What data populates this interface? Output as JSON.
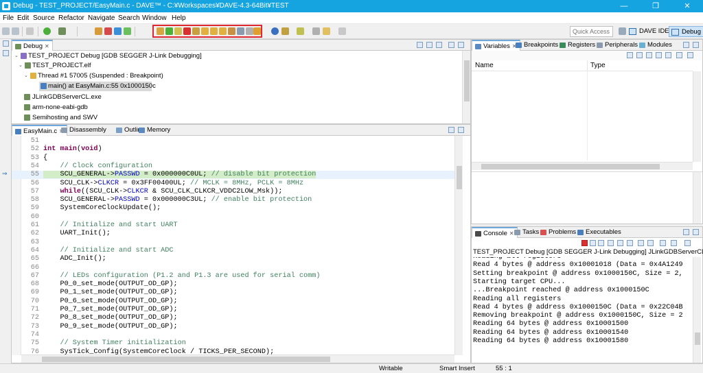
{
  "window": {
    "title": "Debug - TEST_PROJECT/EasyMain.c - DAVE™ - C:¥Workspaces¥DAVE-4.3-64Bit¥TEST",
    "minimize": "—",
    "maximize": "❐",
    "close": "✕"
  },
  "menu": [
    "File",
    "Edit",
    "Source",
    "Refactor",
    "Navigate",
    "Search",
    "Window",
    "Help"
  ],
  "toolbar": {
    "quick_access_placeholder": "Quick Access",
    "perspectives": [
      "DAVE IDE",
      "Debug"
    ],
    "highlight_color": "#e0262f"
  },
  "debug_view": {
    "tab": "Debug",
    "tree": [
      {
        "label": "TEST_PROJECT Debug [GDB SEGGER J-Link Debugging]",
        "twisty": "⌄"
      },
      {
        "label": "TEST_PROJECT.elf",
        "twisty": "⌄"
      },
      {
        "label": "Thread #1 57005 (Suspended : Breakpoint)",
        "twisty": "⌄"
      },
      {
        "label": "main() at EasyMain.c:55 0x1000150c",
        "twisty": ""
      },
      {
        "label": "JLinkGDBServerCL.exe",
        "twisty": ""
      },
      {
        "label": "arm-none-eabi-gdb",
        "twisty": ""
      },
      {
        "label": "Semihosting and SWV",
        "twisty": ""
      }
    ]
  },
  "editor": {
    "tabs": [
      "EasyMain.c",
      "Disassembly",
      "Outline",
      "Memory"
    ],
    "lines": [
      {
        "n": "51",
        "segs": []
      },
      {
        "n": "52",
        "segs": [
          {
            "t": "int",
            "c": "kw"
          },
          {
            "t": " "
          },
          {
            "t": "main",
            "c": "kw"
          },
          {
            "t": "("
          },
          {
            "t": "void",
            "c": "kw"
          },
          {
            "t": ")"
          }
        ]
      },
      {
        "n": "53",
        "segs": [
          {
            "t": "{"
          }
        ]
      },
      {
        "n": "54",
        "segs": [
          {
            "t": "    // Clock configuration",
            "c": "cm"
          }
        ]
      },
      {
        "n": "55",
        "segs": [
          {
            "t": "    SCU_GENERAL->",
            "c": "hlgreen"
          },
          {
            "t": "PASSWD",
            "c": "fld hlgreen"
          },
          {
            "t": " = 0x000000C0UL; ",
            "c": "hlgreen"
          },
          {
            "t": "// disable bit protection",
            "c": "cm hlgreen"
          }
        ]
      },
      {
        "n": "56",
        "segs": [
          {
            "t": "    SCU_CLK->"
          },
          {
            "t": "CLKCR",
            "c": "fld"
          },
          {
            "t": " = 0x3FF00400UL; "
          },
          {
            "t": "// MCLK = 8MHz, PCLK = 8MHz",
            "c": "cm"
          }
        ]
      },
      {
        "n": "57",
        "segs": [
          {
            "t": "    "
          },
          {
            "t": "while",
            "c": "kw"
          },
          {
            "t": "((SCU_CLK->"
          },
          {
            "t": "CLKCR",
            "c": "fld"
          },
          {
            "t": " & SCU_CLK_CLKCR_VDDC2LOW_Msk));"
          }
        ]
      },
      {
        "n": "58",
        "segs": [
          {
            "t": "    SCU_GENERAL->"
          },
          {
            "t": "PASSWD",
            "c": "fld"
          },
          {
            "t": " = 0x000000C3UL; "
          },
          {
            "t": "// enable bit protection",
            "c": "cm"
          }
        ]
      },
      {
        "n": "59",
        "segs": [
          {
            "t": "    SystemCoreClockUpdate();"
          }
        ]
      },
      {
        "n": "60",
        "segs": []
      },
      {
        "n": "61",
        "segs": [
          {
            "t": "    // Initialize and start UART",
            "c": "cm"
          }
        ]
      },
      {
        "n": "62",
        "segs": [
          {
            "t": "    UART_Init();"
          }
        ]
      },
      {
        "n": "63",
        "segs": []
      },
      {
        "n": "64",
        "segs": [
          {
            "t": "    // Initialize and start ADC",
            "c": "cm"
          }
        ]
      },
      {
        "n": "65",
        "segs": [
          {
            "t": "    ADC_Init();"
          }
        ]
      },
      {
        "n": "66",
        "segs": []
      },
      {
        "n": "67",
        "segs": [
          {
            "t": "    // LEDs configuration (P1.2 and P1.3 are used for serial comm)",
            "c": "cm"
          }
        ]
      },
      {
        "n": "68",
        "segs": [
          {
            "t": "    P0_0_set_mode(OUTPUT_OD_GP);"
          }
        ]
      },
      {
        "n": "69",
        "segs": [
          {
            "t": "    P0_1_set_mode(OUTPUT_OD_GP);"
          }
        ]
      },
      {
        "n": "70",
        "segs": [
          {
            "t": "    P0_6_set_mode(OUTPUT_OD_GP);"
          }
        ]
      },
      {
        "n": "71",
        "segs": [
          {
            "t": "    P0_7_set_mode(OUTPUT_OD_GP);"
          }
        ]
      },
      {
        "n": "72",
        "segs": [
          {
            "t": "    P0_8_set_mode(OUTPUT_OD_GP);"
          }
        ]
      },
      {
        "n": "73",
        "segs": [
          {
            "t": "    P0_9_set_mode(OUTPUT_OD_GP);"
          }
        ]
      },
      {
        "n": "74",
        "segs": []
      },
      {
        "n": "75",
        "segs": [
          {
            "t": "    // System Timer initialization",
            "c": "cm"
          }
        ]
      },
      {
        "n": "76",
        "segs": [
          {
            "t": "    SysTick_Config(SystemCoreClock / TICKS_PER_SECOND);"
          }
        ]
      }
    ]
  },
  "variables_view": {
    "tabs": [
      "Variables",
      "Breakpoints",
      "Registers",
      "Peripherals",
      "Modules"
    ],
    "columns": [
      "Name",
      "Type"
    ]
  },
  "console_view": {
    "tabs": [
      "Console",
      "Tasks",
      "Problems",
      "Executables"
    ],
    "header": "TEST_PROJECT Debug [GDB SEGGER J-Link Debugging] JLinkGDBServerCL.exe",
    "lines": [
      "Reading all registers",
      "Read 4 bytes @ address 0x10001018 (Data = 0x4A1249",
      "Setting breakpoint @ address 0x1000150C, Size = 2,",
      "Starting target CPU...",
      "...Breakpoint reached @ address 0x1000150C",
      "Reading all registers",
      "Read 4 bytes @ address 0x1000150C (Data = 0x22C04B",
      "Removing breakpoint @ address 0x1000150C, Size = 2",
      "Reading 64 bytes @ address 0x10001500",
      "Reading 64 bytes @ address 0x10001540",
      "Reading 64 bytes @ address 0x10001580"
    ]
  },
  "status": {
    "writable": "Writable",
    "insert_mode": "Smart Insert",
    "position": "55 : 1"
  }
}
